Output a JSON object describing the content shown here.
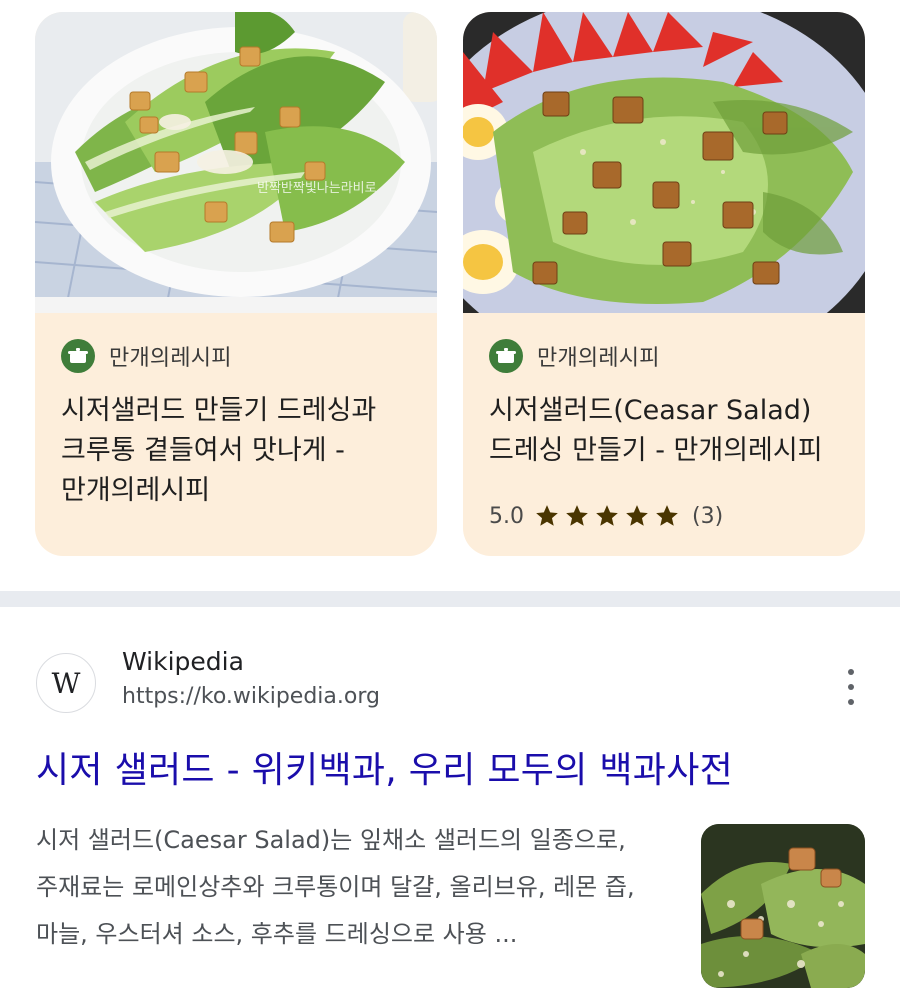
{
  "cards": [
    {
      "source": "만개의레시피",
      "source_icon": "pot-icon",
      "title": "시저샐러드 만들기 드레싱과 크루통 곁들여서 맛나게 - 만개의레시피",
      "image_watermark": "반짝반짝빛나는라비로"
    },
    {
      "source": "만개의레시피",
      "source_icon": "pot-icon",
      "title": "시저샐러드(Ceasar Salad) 드레싱 만들기 - 만개의레시피",
      "rating": "5.0",
      "stars": 5,
      "rating_count": "(3)"
    }
  ],
  "result": {
    "logo_letter": "W",
    "site_name": "Wikipedia",
    "url": "https://ko.wikipedia.org",
    "title": "시저 샐러드 - 위키백과, 우리 모두의 백과사전",
    "snippet": "시저 샐러드(Caesar Salad)는 잎채소 샐러드의 일종으로, 주재료는 로메인상추와 크루통이며 달걀, 올리브유, 레몬 즙, 마늘, 우스터셔 소스, 후추를 드레싱으로 사용 ..."
  },
  "colors": {
    "card_bg": "#fdeedb",
    "link": "#1a0dab",
    "star": "#4a3500",
    "divider": "#e8ebf0",
    "source_logo": "#3f7d3a"
  }
}
